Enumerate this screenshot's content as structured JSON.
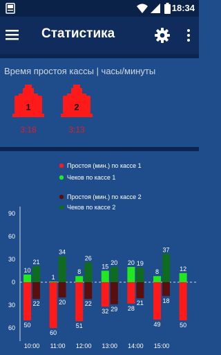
{
  "status_bar": {
    "time": "18:34"
  },
  "toolbar": {
    "title": "Статистика"
  },
  "idle": {
    "heading": "Время простоя кассы | часы/минуты",
    "registers": [
      {
        "number": "1",
        "time": "3:18"
      },
      {
        "number": "2",
        "time": "3:13"
      }
    ]
  },
  "colors": {
    "idle_1": "#ff1a1a",
    "checks_1": "#22e822",
    "idle_2": "#5a0f0f",
    "checks_2": "#0f6b1f",
    "background": "#1f4d8c"
  },
  "chart_data": {
    "type": "bar",
    "categories": [
      "10:00",
      "11:00",
      "12:00",
      "13:00",
      "14:00",
      "15:00",
      ""
    ],
    "series": [
      {
        "name": "Простоя (мин.) по кассе 1",
        "direction": "down",
        "values": [
          50,
          60,
          51,
          32,
          28,
          49,
          50
        ]
      },
      {
        "name": "Чеков по кассе 1",
        "direction": "up",
        "values": [
          10,
          1,
          8,
          15,
          20,
          8,
          12
        ]
      },
      {
        "name": "Простоя (мин.) по кассе 2",
        "direction": "down",
        "values": [
          22,
          20,
          22,
          29,
          21,
          18,
          null
        ]
      },
      {
        "name": "Чеков по кассе 2",
        "direction": "up",
        "values": [
          21,
          34,
          26,
          20,
          19,
          37,
          null
        ]
      }
    ],
    "y_ticks": [
      "90",
      "60",
      "30",
      "0",
      "30",
      "60"
    ],
    "ylim": [
      -60,
      90
    ],
    "legend_position": "top"
  }
}
